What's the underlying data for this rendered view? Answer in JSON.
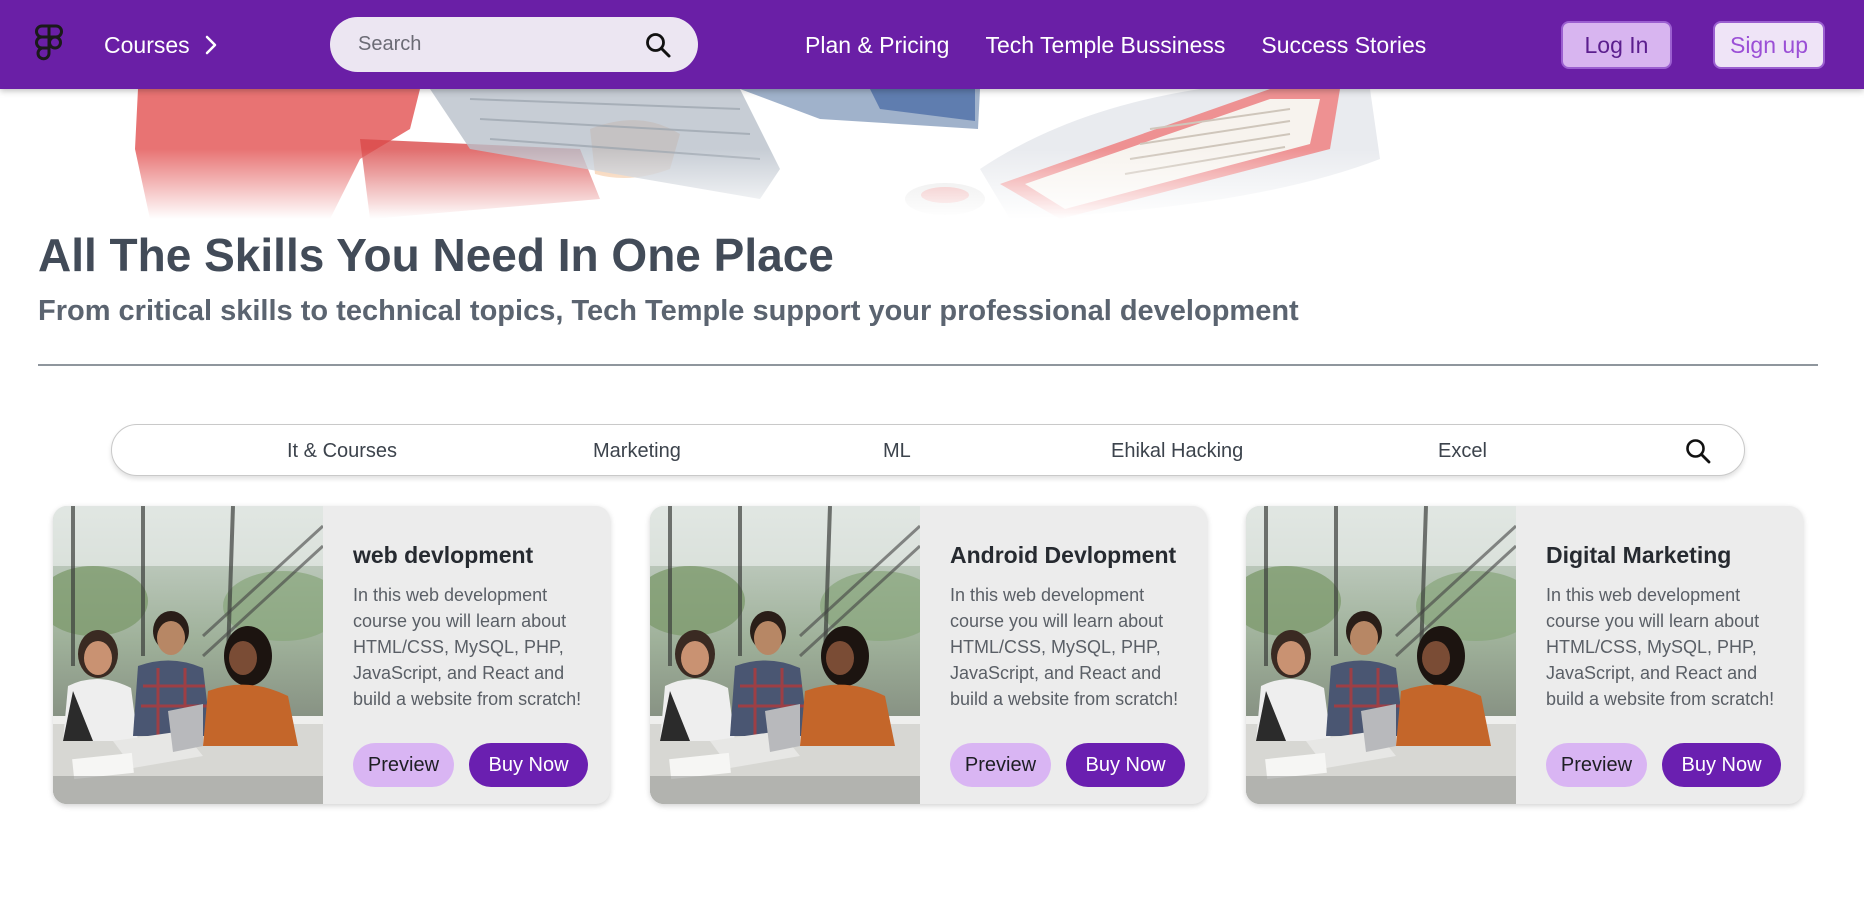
{
  "colors": {
    "navbar": "#6a1fa6",
    "accent": "#6a1fb0",
    "preview_button": "#d9b5f3",
    "login_button": "#d8b5f0",
    "card_bg": "#ececec"
  },
  "navbar": {
    "courses_label": "Courses",
    "search_placeholder": "Search",
    "links": [
      "Plan & Pricing",
      "Tech Temple Bussiness",
      "Success Stories"
    ],
    "login_label": "Log In",
    "signup_label": "Sign up"
  },
  "hero": {
    "title": "All The Skills You Need In One Place",
    "subtitle": "From critical skills to technical topics, Tech Temple support your professional development"
  },
  "categories": [
    "It & Courses",
    "Marketing",
    "ML",
    "Ehikal Hacking",
    "Excel"
  ],
  "cards": [
    {
      "title": "web devlopment",
      "description": "In this web development course you will learn about HTML/CSS, MySQL, PHP, JavaScript, and React and build a website from scratch!",
      "preview_label": "Preview",
      "buy_label": "Buy Now"
    },
    {
      "title": "Android Devlopment",
      "description": "In this web development course you will learn about HTML/CSS, MySQL, PHP, JavaScript, and React and build a website from scratch!",
      "preview_label": "Preview",
      "buy_label": "Buy Now"
    },
    {
      "title": "Digital Marketing",
      "description": "In this web development course you will learn about HTML/CSS, MySQL, PHP, JavaScript, and React and build a website from scratch!",
      "preview_label": "Preview",
      "buy_label": "Buy Now"
    }
  ]
}
